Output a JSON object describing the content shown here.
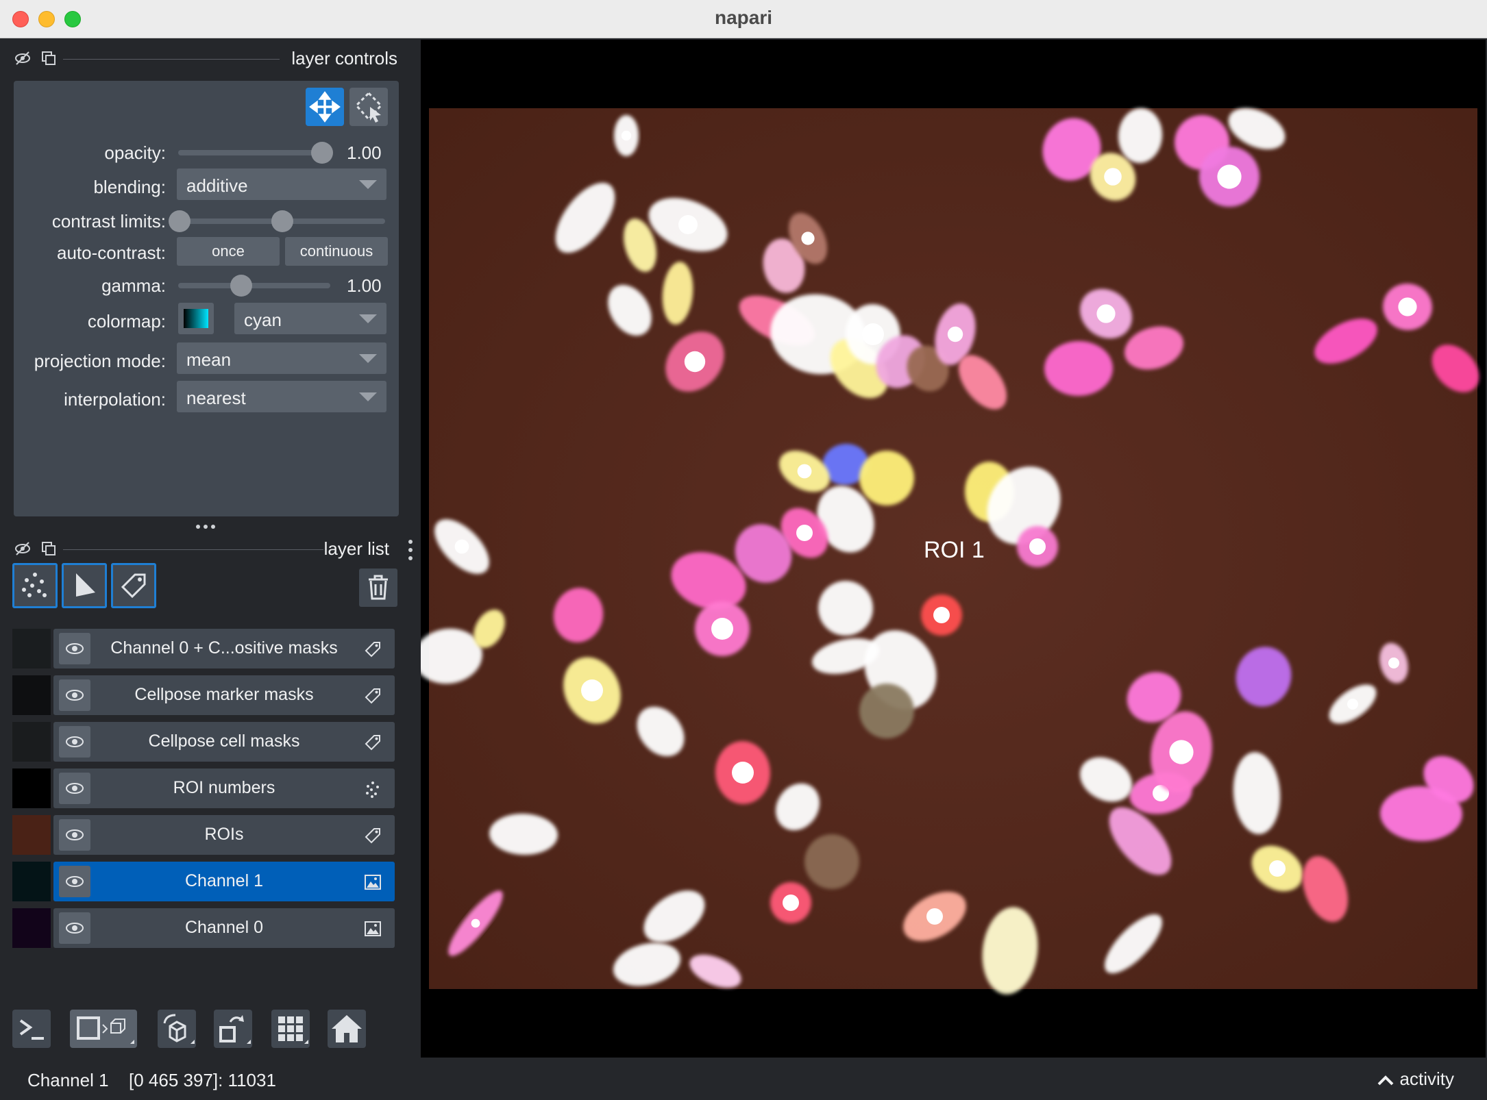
{
  "window": {
    "title": "napari"
  },
  "layer_controls": {
    "header": "layer controls",
    "opacity": {
      "label": "opacity:",
      "value": "1.00",
      "level": 1.0
    },
    "blending": {
      "label": "blending:",
      "value": "additive"
    },
    "contrast_limits": {
      "label": "contrast limits:",
      "low": 0.0,
      "high": 0.5
    },
    "auto_contrast": {
      "label": "auto-contrast:",
      "once": "once",
      "continuous": "continuous"
    },
    "gamma": {
      "label": "gamma:",
      "value": "1.00",
      "level": 0.45
    },
    "colormap": {
      "label": "colormap:",
      "value": "cyan",
      "swatch_color": "#00e5ff"
    },
    "projection_mode": {
      "label": "projection mode:",
      "value": "mean"
    },
    "interpolation": {
      "label": "interpolation:",
      "value": "nearest"
    }
  },
  "layer_list": {
    "header": "layer list",
    "new_layer_buttons": [
      "new-points-icon",
      "new-shapes-icon",
      "new-labels-icon"
    ],
    "delete_icon": "trash-icon",
    "layers": [
      {
        "name": "Channel 0 + C...ositive masks",
        "type_icon": "labels-icon",
        "selected": false
      },
      {
        "name": "Cellpose marker masks",
        "type_icon": "labels-icon",
        "selected": false
      },
      {
        "name": "Cellpose cell masks",
        "type_icon": "labels-icon",
        "selected": false
      },
      {
        "name": "ROI numbers",
        "type_icon": "points-icon",
        "selected": false
      },
      {
        "name": "ROIs",
        "type_icon": "labels-icon",
        "selected": false
      },
      {
        "name": "Channel 1",
        "type_icon": "image-icon",
        "selected": true
      },
      {
        "name": "Channel 0",
        "type_icon": "image-icon",
        "selected": false
      }
    ]
  },
  "viewer_buttons": [
    "console-icon",
    "ndisplay-toggle-icon",
    "roll-dims-icon",
    "transpose-icon",
    "grid-icon",
    "home-icon"
  ],
  "canvas": {
    "roi_label": "ROI 1",
    "background_color": "#5a2a1d"
  },
  "status_bar": {
    "layer": "Channel 1",
    "coords": "[0 465 397]: 11031",
    "activity": "activity"
  }
}
